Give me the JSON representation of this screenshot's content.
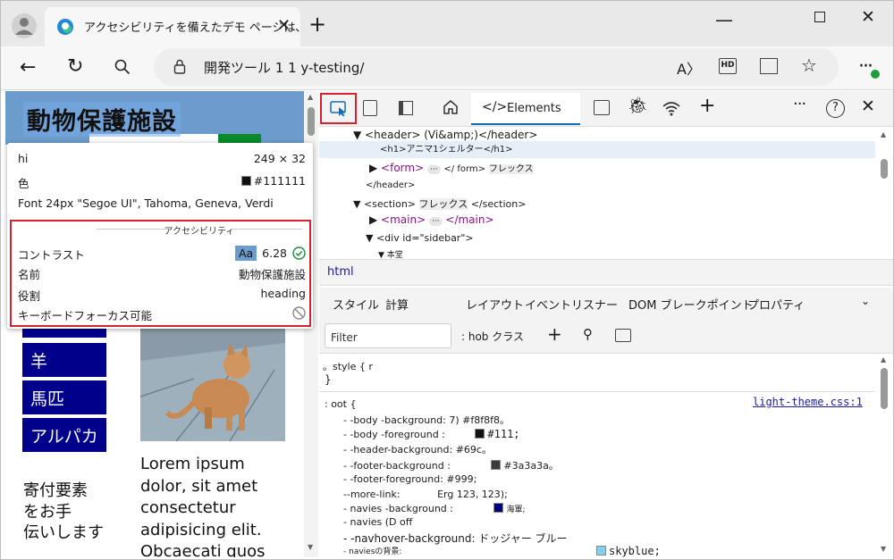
{
  "browser": {
    "tab_title": "アクセシビリティを備えたデモ ページは､",
    "address": "開発ツール 1 1 y-testing/"
  },
  "page": {
    "title": "動物保護施設",
    "nav_items": [
      "羊",
      "馬匹",
      "アルパカ"
    ],
    "lorem_lines": [
      "Lorem ipsum",
      "dolor, sit amet",
      "consectetur",
      "adipisicing elit.",
      "Obcaecati quos"
    ],
    "sidebar_note_lines": [
      "寄付要素",
      "をお手",
      "伝いします"
    ]
  },
  "tooltip": {
    "tag": "hi",
    "size": "249 × 32",
    "color_label": "色",
    "color_value": "#111111",
    "color_swatch": "#111111",
    "font": "Font 24px \"Segoe UI\", Tahoma, Geneva, Verdi",
    "accessibility_title": "アクセシビリティ",
    "contrast_label": "コントラスト",
    "contrast_sample": "Aa",
    "contrast_value": "6.28",
    "name_label": "名前",
    "name_value": "動物保護施設",
    "role_label": "役割",
    "role_value": "heading",
    "keyboard_label": "キーボードフォーカス可能"
  },
  "devtools": {
    "elements_tab": "Elements",
    "dom_lines": [
      "<header> (Vi&amp;)</header>",
      "<h1>アニマ1シェルター</h1>",
      "<form>",
      "</ form>",
      "フレックス",
      "</header>",
      "<section>",
      "フレックス",
      "</section>",
      "<main>",
      "</main>",
      "<div id=\"sidebar\">",
      "本堂"
    ],
    "breadcrumb": "html",
    "subtabs": [
      "スタイル",
      "計算",
      "レイアウト",
      "イベントリスナー",
      "DOM ブレークポイント",
      "プロパティ"
    ],
    "filter_placeholder": "Filter",
    "hov_cls": ": hob クラス",
    "element_style": [
      "。style { r",
      "}"
    ],
    "root_selector": ": oot {",
    "stylesheet_link": "light-theme.css:1",
    "css_lines": [
      {
        "text": "- -body -background: 7) #f8f8f8。",
        "swatch": null
      },
      {
        "text": "- -body -foreground :",
        "swatch": "#111111",
        "value": "#111;"
      },
      {
        "text": "- -header-background: #69c。",
        "swatch": null
      },
      {
        "text": "- -footer-background :",
        "swatch": "#3a3a3a",
        "value": "#3a3a3a。"
      },
      {
        "text": "- -footer-foreground: #999;",
        "swatch": null
      },
      {
        "text": "--more-link:",
        "swatch": null,
        "value": "Erg 123, 123);"
      },
      {
        "text": "- navies -background :",
        "swatch": "#000080",
        "value": "海軍;"
      },
      {
        "text": "- navies (D off",
        "swatch": null
      },
      {
        "text": "- -navhover-background: ドッジャー ブルー",
        "swatch": null
      },
      {
        "text": "- naviesの背景:",
        "swatch": "#87ceeb",
        "value": "skyblue;"
      }
    ]
  },
  "colors": {
    "page_header": "#6c9ccc",
    "nav_box": "#00008b",
    "highlight_red": "#d6212e",
    "accent_blue": "#0f6cbd"
  }
}
